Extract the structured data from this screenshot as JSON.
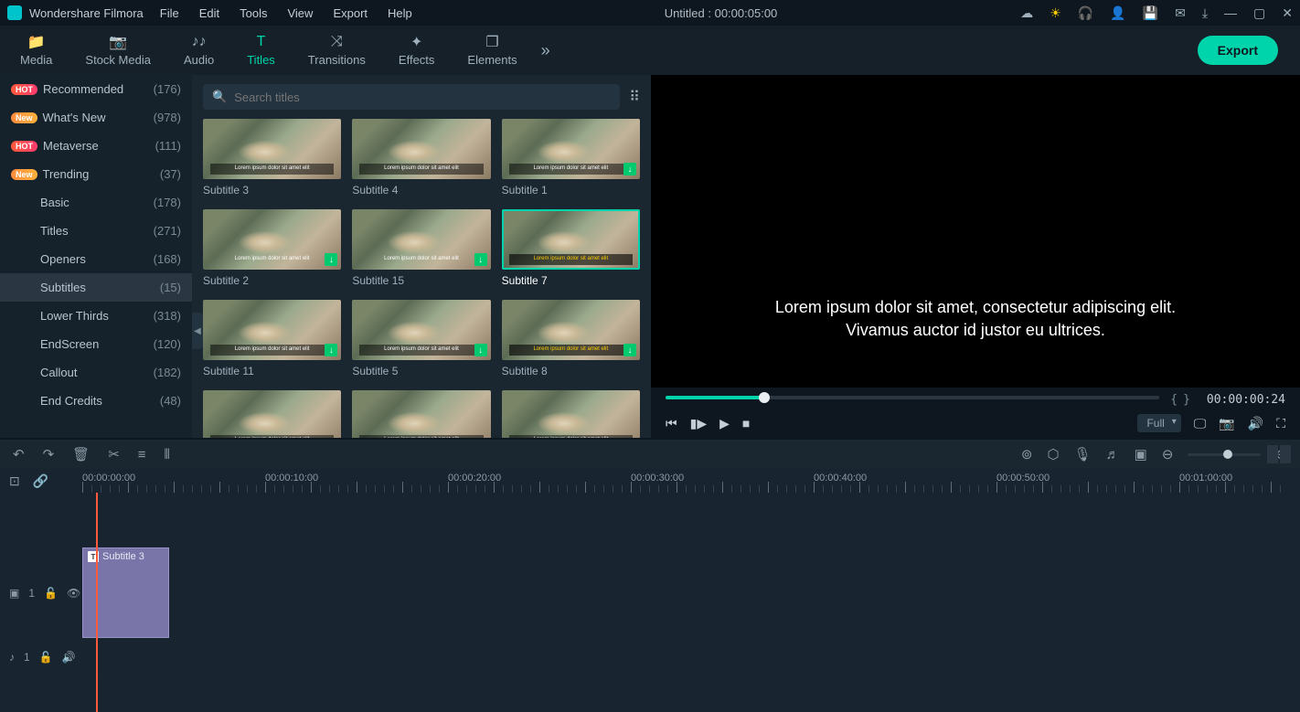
{
  "app": {
    "name": "Wondershare Filmora",
    "project_title": "Untitled : 00:00:05:00"
  },
  "menus": [
    "File",
    "Edit",
    "Tools",
    "View",
    "Export",
    "Help"
  ],
  "tabs": [
    {
      "label": "Media",
      "icon": "📁"
    },
    {
      "label": "Stock Media",
      "icon": "📷"
    },
    {
      "label": "Audio",
      "icon": "♪"
    },
    {
      "label": "Titles",
      "icon": "T",
      "active": true
    },
    {
      "label": "Transitions",
      "icon": "⤨"
    },
    {
      "label": "Effects",
      "icon": "✦"
    },
    {
      "label": "Elements",
      "icon": "❐"
    }
  ],
  "export_label": "Export",
  "sidebar": [
    {
      "badge": "HOT",
      "label": "Recommended",
      "count": "(176)"
    },
    {
      "badge": "New",
      "label": "What's New",
      "count": "(978)"
    },
    {
      "badge": "HOT",
      "label": "Metaverse",
      "count": "(111)"
    },
    {
      "badge": "New",
      "label": "Trending",
      "count": "(37)"
    },
    {
      "badge": "",
      "label": "Basic",
      "count": "(178)"
    },
    {
      "badge": "",
      "label": "Titles",
      "count": "(271)"
    },
    {
      "badge": "",
      "label": "Openers",
      "count": "(168)"
    },
    {
      "badge": "",
      "label": "Subtitles",
      "count": "(15)",
      "active": true
    },
    {
      "badge": "",
      "label": "Lower Thirds",
      "count": "(318)"
    },
    {
      "badge": "",
      "label": "EndScreen",
      "count": "(120)"
    },
    {
      "badge": "",
      "label": "Callout",
      "count": "(182)"
    },
    {
      "badge": "",
      "label": "End Credits",
      "count": "(48)"
    }
  ],
  "search": {
    "placeholder": "Search titles"
  },
  "thumbs": [
    {
      "label": "Subtitle 3",
      "sub_class": "sub-white"
    },
    {
      "label": "Subtitle 4",
      "sub_class": "sub-white"
    },
    {
      "label": "Subtitle 1",
      "dl": true,
      "sub_class": "sub-white"
    },
    {
      "label": "Subtitle 2",
      "dl": true,
      "sub_class": "sub-plain"
    },
    {
      "label": "Subtitle 15",
      "dl": true,
      "sub_class": "sub-plain"
    },
    {
      "label": "Subtitle 7",
      "selected": true,
      "sub_class": "sub-yellow"
    },
    {
      "label": "Subtitle 11",
      "dl": true,
      "sub_class": "sub-white"
    },
    {
      "label": "Subtitle 5",
      "dl": true,
      "sub_class": "sub-white"
    },
    {
      "label": "Subtitle 8",
      "dl": true,
      "sub_class": "sub-yellow"
    },
    {
      "label": "",
      "sub_class": "sub-white"
    },
    {
      "label": "",
      "sub_class": "sub-white"
    },
    {
      "label": "",
      "sub_class": "sub-white"
    }
  ],
  "thumb_subtext": "Lorem ipsum dolor sit amet elit",
  "preview": {
    "line1": "Lorem ipsum dolor sit amet, consectetur adipiscing elit.",
    "line2": "Vivamus auctor id justor eu ultrices.",
    "timecode": "00:00:00:24",
    "quality": "Full"
  },
  "ruler": [
    "00:00:00:00",
    "00:00:10:00",
    "00:00:20:00",
    "00:00:30:00",
    "00:00:40:00",
    "00:00:50:00",
    "00:01:00:00"
  ],
  "clip": {
    "label": "Subtitle 3"
  },
  "track_text": {
    "label": "1"
  },
  "track_audio": {
    "label": "1"
  }
}
